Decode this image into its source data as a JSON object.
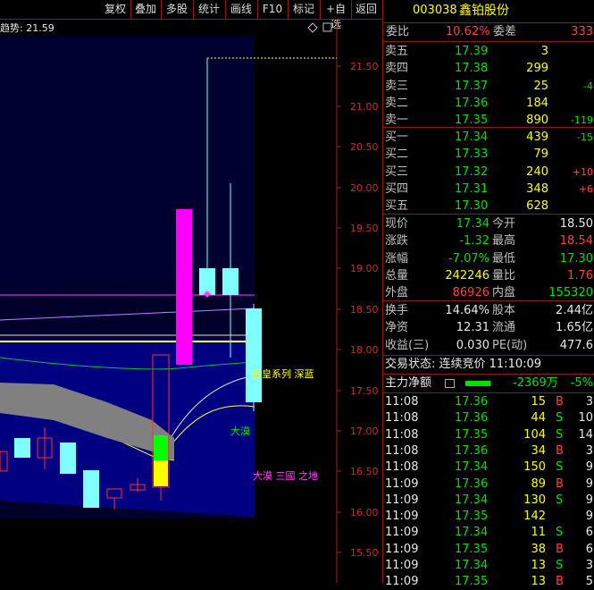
{
  "toolbar": {
    "buttons": [
      "复权",
      "叠加",
      "多股",
      "统计",
      "画线",
      "F10",
      "标记",
      "+自选",
      "返回"
    ]
  },
  "chart": {
    "indicator_label": "趋势: 21.59",
    "price_ticks": [
      "21.50",
      "21.00",
      "20.50",
      "20.00",
      "19.50",
      "19.00",
      "18.50",
      "18.00",
      "17.50",
      "17.00",
      "16.50",
      "16.00",
      "15.50"
    ],
    "annotations": {
      "baihuang": "白皇系列 深蓝",
      "damo": "大漠",
      "bottom": "大漠 三國 之地"
    }
  },
  "stock": {
    "code": "003038",
    "name": "鑫铂股份"
  },
  "ratio": {
    "label1": "委比",
    "value1": "10.62%",
    "label2": "委差",
    "value2": "333"
  },
  "asks": [
    {
      "label": "卖五",
      "price": "17.39",
      "vol": "3",
      "chg": ""
    },
    {
      "label": "卖四",
      "price": "17.38",
      "vol": "299",
      "chg": ""
    },
    {
      "label": "卖三",
      "price": "17.37",
      "vol": "25",
      "chg": "-4"
    },
    {
      "label": "卖二",
      "price": "17.36",
      "vol": "184",
      "chg": ""
    },
    {
      "label": "卖一",
      "price": "17.35",
      "vol": "890",
      "chg": "-119"
    }
  ],
  "bids": [
    {
      "label": "买一",
      "price": "17.34",
      "vol": "439",
      "chg": "-15"
    },
    {
      "label": "买二",
      "price": "17.33",
      "vol": "79",
      "chg": ""
    },
    {
      "label": "买三",
      "price": "17.32",
      "vol": "240",
      "chg": "+10"
    },
    {
      "label": "买四",
      "price": "17.31",
      "vol": "348",
      "chg": "+6"
    },
    {
      "label": "买五",
      "price": "17.30",
      "vol": "628",
      "chg": ""
    }
  ],
  "quote": [
    {
      "l1": "现价",
      "v1": "17.34",
      "l2": "今开",
      "v2": "18.50"
    },
    {
      "l1": "涨跌",
      "v1": "-1.32",
      "l2": "最高",
      "v2": "18.54"
    },
    {
      "l1": "涨幅",
      "v1": "-7.07%",
      "l2": "最低",
      "v2": "17.30"
    },
    {
      "l1": "总量",
      "v1": "242246",
      "l2": "量比",
      "v2": "1.76"
    },
    {
      "l1": "外盘",
      "v1": "86926",
      "l2": "内盘",
      "v2": "155320"
    }
  ],
  "stats": [
    {
      "l1": "换手",
      "v1": "14.64%",
      "l2": "股本",
      "v2": "2.44亿"
    },
    {
      "l1": "净资",
      "v1": "12.31",
      "l2": "流通",
      "v2": "1.65亿"
    },
    {
      "l1": "收益(三)",
      "v1": "0.030",
      "l2": "PE(动)",
      "v2": "477.6"
    }
  ],
  "trade_status": "交易状态: 连续竞价 11:10:09",
  "main_flow": {
    "label": "主力净额",
    "value": "-2369万",
    "pct": "-5%"
  },
  "ticks": [
    {
      "time": "11:08",
      "price": "17.36",
      "vol": "15",
      "side": "B",
      "n": "3"
    },
    {
      "time": "11:08",
      "price": "17.36",
      "vol": "44",
      "side": "S",
      "n": "10"
    },
    {
      "time": "11:08",
      "price": "17.35",
      "vol": "104",
      "side": "S",
      "n": "14"
    },
    {
      "time": "11:08",
      "price": "17.36",
      "vol": "34",
      "side": "B",
      "n": "3"
    },
    {
      "time": "11:08",
      "price": "17.34",
      "vol": "150",
      "side": "S",
      "n": "9"
    },
    {
      "time": "11:09",
      "price": "17.36",
      "vol": "89",
      "side": "B",
      "n": "9"
    },
    {
      "time": "11:09",
      "price": "17.34",
      "vol": "130",
      "side": "S",
      "n": "9"
    },
    {
      "time": "11:09",
      "price": "17.35",
      "vol": "142",
      "side": "",
      "n": "9"
    },
    {
      "time": "11:09",
      "price": "17.34",
      "vol": "11",
      "side": "S",
      "n": "6"
    },
    {
      "time": "11:09",
      "price": "17.35",
      "vol": "38",
      "side": "B",
      "n": "6"
    },
    {
      "time": "11:09",
      "price": "17.34",
      "vol": "13",
      "side": "S",
      "n": "3"
    },
    {
      "time": "11:09",
      "price": "17.35",
      "vol": "13",
      "side": "B",
      "n": "5"
    }
  ]
}
